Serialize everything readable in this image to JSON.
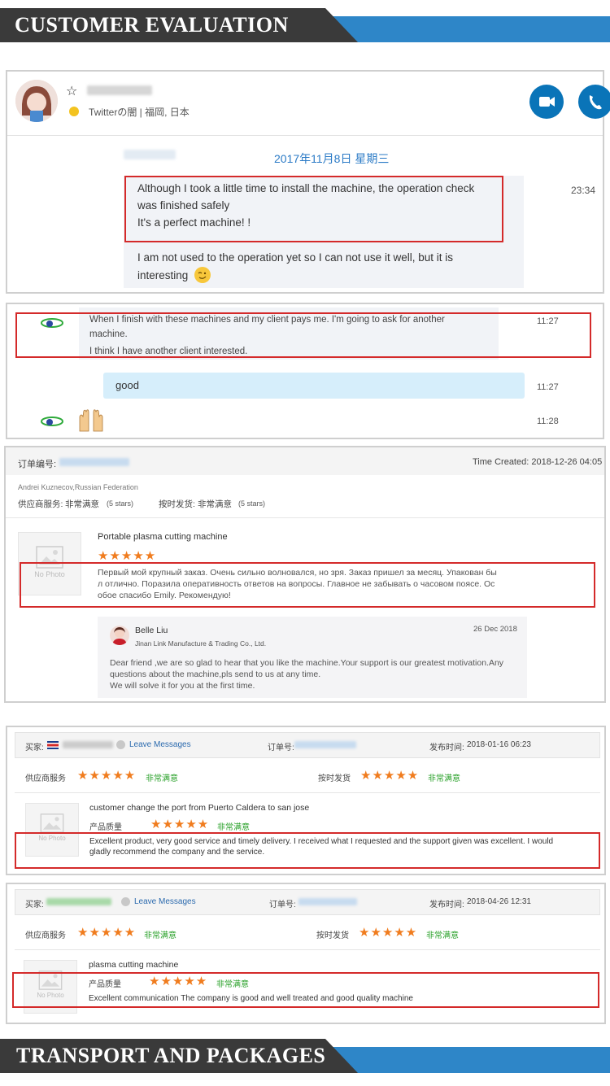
{
  "banners": {
    "top_title": "CUSTOMER EVALUATION",
    "bottom_title": "TRANSPORT AND PACKAGES"
  },
  "chat1": {
    "contact_location": "Twitterの闇 | 福岡, 日本",
    "date_header": "2017年11月8日 星期三",
    "message_1_line1": "Although I took a little time to install the machine, the operation check",
    "message_1_line2": "was finished safely",
    "message_1_line3": "It's a perfect machine! !",
    "message_2_line1": "I am not used to the operation yet so I can not use it well, but it is",
    "message_2_line2": "interesting",
    "time": "23:34"
  },
  "chat2": {
    "msg_line1": "When I finish with these machines and my client pays me. I'm going to ask for another",
    "msg_line2": "machine.",
    "msg_line3": "I think I have another client interested.",
    "time1": "11:27",
    "reply": "good",
    "time2": "11:27",
    "time3": "11:28"
  },
  "order1": {
    "order_label": "订单编号:",
    "time_created": "Time Created: 2018-12-26 04:05",
    "buyer": "Andrei Kuznecov,Russian Federation",
    "rating1_label": "供应商服务:",
    "rating1_value": "非常满意",
    "rating1_stars": "(5 stars)",
    "rating2_label": "按时发货:",
    "rating2_value": "非常满意",
    "rating2_stars": "(5 stars)",
    "product": "Portable plasma cutting machine",
    "no_photo": "No Photo",
    "review_line1": "Первый мой крупный заказ. Очень сильно волновался, но зря. Заказ пришел за месяц. Упакован бы",
    "review_line2": "л отлично. Поразила оперативность ответов на вопросы. Главное не забывать о часовом поясе. Ос",
    "review_line3": "обое спасибо Emily. Рекомендую!",
    "reply_name": "Belle Liu",
    "reply_company": "Jinan Link Manufacture & Trading Co., Ltd.",
    "reply_date": "26 Dec 2018",
    "reply_line1": "Dear friend ,we are so glad to hear that you like the machine.Your support is our greatest motivation.Any",
    "reply_line2": "questions about the machine,pls send to us at any time.",
    "reply_line3": "We will solve it for you at the first time."
  },
  "order2": {
    "buyer_label": "买家:",
    "leave_messages": "Leave Messages",
    "order_label": "订单号:",
    "publish_label": "发布时间:",
    "publish_time": "2018-01-16 06:23",
    "service_label": "供应商服务",
    "service_value": "非常满意",
    "shipping_label": "按时发货",
    "shipping_value": "非常满意",
    "product": "customer change the port from Puerto Caldera to san jose",
    "quality_label": "产品质量",
    "quality_value": "非常满意",
    "no_photo": "No Photo",
    "review_line1": "Excellent product, very good service and timely delivery. I received what I requested and the support given was excellent. I would",
    "review_line2": "gladly recommend the company and the service."
  },
  "order3": {
    "buyer_label": "买家:",
    "leave_messages": "Leave Messages",
    "order_label": "订单号:",
    "publish_label": "发布时间:",
    "publish_time": "2018-04-26 12:31",
    "service_label": "供应商服务",
    "service_value": "非常满意",
    "shipping_label": "按时发货",
    "shipping_value": "非常满意",
    "product": "plasma cutting machine",
    "quality_label": "产品质量",
    "quality_value": "非常满意",
    "no_photo": "No Photo",
    "review_line1": "Excellent communication The company is good and well treated and good quality machine"
  },
  "stars_glyph": "★★★★★",
  "colors": {
    "banner_blue": "#2e86c8",
    "banner_dark": "#3a3a3a",
    "highlight_red": "#d42a2a",
    "star_orange": "#f07c1e",
    "satisfied_green": "#28a028",
    "call_button": "#0a74b8"
  }
}
